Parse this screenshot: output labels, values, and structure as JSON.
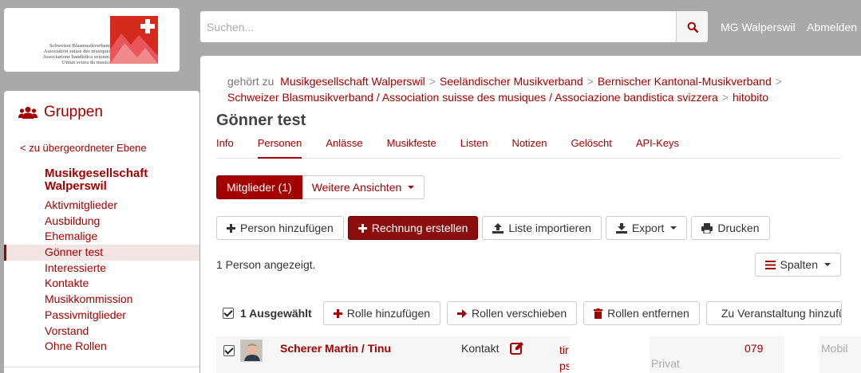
{
  "logo": {
    "lines": [
      "Schweizer Blasmusikverband",
      "Association suisse des musiques",
      "Associazione bandistica svizzera",
      "Uniun svizra da musica"
    ]
  },
  "topbar": {
    "search_placeholder": "Suchen...",
    "user_link": "MG Walperswil",
    "logout_link": "Abmelden"
  },
  "sidebar": {
    "title": "Gruppen",
    "back_link": "< zu übergeordneter Ebene",
    "group_name": "Musikgesellschaft Walperswil",
    "items": [
      {
        "label": "Aktivmitglieder"
      },
      {
        "label": "Ausbildung"
      },
      {
        "label": "Ehemalige"
      },
      {
        "label": "Gönner test"
      },
      {
        "label": "Interessierte"
      },
      {
        "label": "Kontakte"
      },
      {
        "label": "Musikkommission"
      },
      {
        "label": "Passivmitglieder"
      },
      {
        "label": "Vorstand"
      },
      {
        "label": "Ohne Rollen"
      }
    ],
    "active_index": 3
  },
  "breadcrumb": {
    "prefix": "gehört zu",
    "items": [
      "Musikgesellschaft Walperswil",
      "Seeländischer Musikverband",
      "Bernischer Kantonal-Musikverband",
      "Schweizer Blasmusikverband / Association suisse des musiques / Associazione bandistica svizzera",
      "hitobito"
    ]
  },
  "page": {
    "title": "Gönner test",
    "tabs": [
      "Info",
      "Personen",
      "Anlässe",
      "Musikfeste",
      "Listen",
      "Notizen",
      "Gelöscht",
      "API-Keys"
    ],
    "active_tab": 1
  },
  "views": {
    "members": "Mitglieder (1)",
    "more": "Weitere Ansichten"
  },
  "actions": {
    "add_person": "Person hinzufügen",
    "create_invoice": "Rechnung erstellen",
    "import_list": "Liste importieren",
    "export": "Export",
    "print": "Drucken"
  },
  "list": {
    "count_text": "1 Person angezeigt.",
    "columns_button": "Spalten",
    "selected_label": "1 Ausgewählt",
    "bulk_add_role": "Rolle hinzufügen",
    "bulk_move_roles": "Rollen verschieben",
    "bulk_remove_roles": "Rollen entfernen",
    "bulk_to_event": "Zu Veranstaltung hinzufügen"
  },
  "row": {
    "name": "Scherer Martin / Tinu",
    "role": "Kontakt",
    "email_fragment": "tir ps",
    "phone": "079",
    "phone_kind": "Mobil",
    "address_kind": "Privat"
  },
  "colors": {
    "brand": "#a50000",
    "header_bg": "#a9a9a9"
  }
}
